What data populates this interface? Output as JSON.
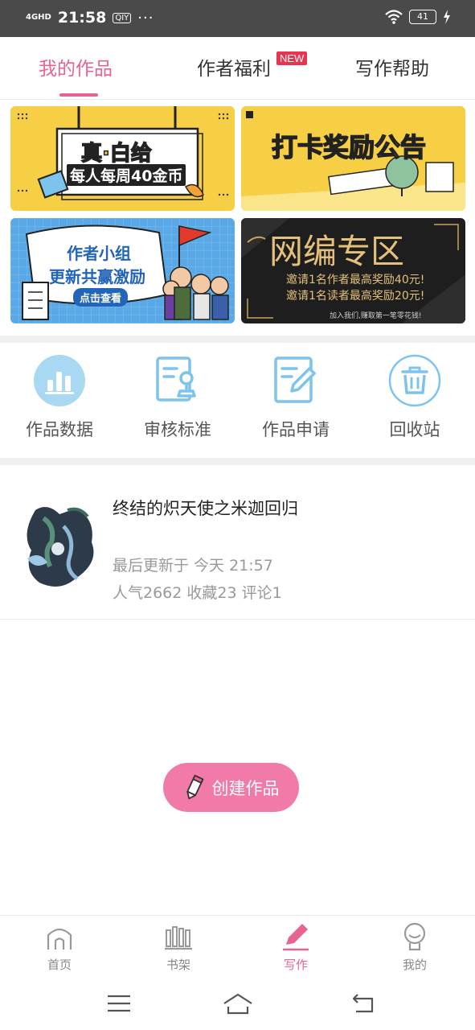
{
  "status_bar": {
    "signal": "4GHD",
    "time": "21:58",
    "app_badge": "QIY",
    "dots": "···",
    "battery": "41"
  },
  "tabs": [
    {
      "label": "我的作品"
    },
    {
      "label": "作者福利",
      "badge": "NEW"
    },
    {
      "label": "写作帮助"
    }
  ],
  "banners": {
    "b1": {
      "line1": "真·白给",
      "line2": "每人每周40金币"
    },
    "b2": {
      "title": "打卡奖励公告"
    },
    "b3": {
      "line1": "作者小组",
      "line2": "更新共赢激励",
      "button": "点击查看"
    },
    "b4": {
      "title": "网编专区",
      "line1": "邀请1名作者最高奖励40元!",
      "line2": "邀请1名读者最高奖励20元!",
      "footer": "加入我们,赚取第一笔零花钱!"
    }
  },
  "shortcuts": [
    {
      "label": "作品数据",
      "icon": "bar-chart-icon"
    },
    {
      "label": "审核标准",
      "icon": "stamp-document-icon"
    },
    {
      "label": "作品申请",
      "icon": "edit-document-icon"
    },
    {
      "label": "回收站",
      "icon": "trash-icon"
    }
  ],
  "work": {
    "title": "终结的炽天使之米迦回归",
    "updated": "最后更新于 今天 21:57",
    "stats": "人气2662 收藏23 评论1"
  },
  "create_button": {
    "label": "创建作品"
  },
  "bottom_nav": [
    {
      "label": "首页",
      "icon": "home-icon"
    },
    {
      "label": "书架",
      "icon": "bookshelf-icon"
    },
    {
      "label": "写作",
      "icon": "pen-icon"
    },
    {
      "label": "我的",
      "icon": "profile-icon"
    }
  ],
  "colors": {
    "accent": "#e8648e",
    "button": "#f17aa8",
    "icon_blue": "#7cc4ec"
  }
}
